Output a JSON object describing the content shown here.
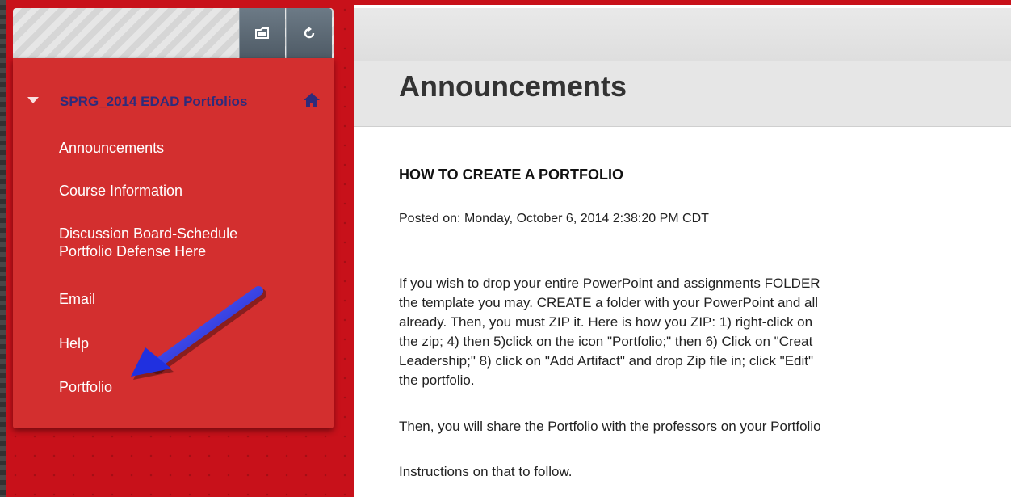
{
  "toolbar": {
    "folder_icon": "folder-view-icon",
    "refresh_icon": "refresh-icon"
  },
  "course_menu": {
    "course_title": "SPRG_2014 EDAD Portfolios",
    "items": [
      {
        "label": "Announcements"
      },
      {
        "label": "Course Information"
      },
      {
        "label_line1": "Discussion Board-Schedule",
        "label_line2": "Portfolio Defense Here"
      },
      {
        "label": "Email"
      },
      {
        "label": "Help"
      },
      {
        "label": "Portfolio"
      }
    ]
  },
  "main": {
    "page_title": "Announcements",
    "announcement": {
      "title": "HOW TO CREATE A PORTFOLIO",
      "posted": "Posted on: Monday, October 6, 2014 2:38:20 PM CDT",
      "paragraph_lines": [
        "If you wish to drop your entire PowerPoint and assignments FOLDER",
        "the template you may. CREATE a folder with your PowerPoint and all",
        "already. Then, you must ZIP it. Here is how you ZIP: 1) right-click on",
        "the zip; 4) then 5)click on the icon \"Portfolio;\" then 6) Click on \"Creat",
        "Leadership;\" 8) click on \"Add Artifact\" and drop Zip file in; click \"Edit\"",
        "the portfolio."
      ],
      "share_line": "Then, you will share the Portfolio with the professors on your Portfolio",
      "instructions_line": "Instructions on that to follow."
    }
  },
  "colors": {
    "accent_red": "#c8111a",
    "menu_red": "#d32f2f",
    "course_title_color": "#2f2b7a",
    "arrow_blue": "#2030e0"
  }
}
